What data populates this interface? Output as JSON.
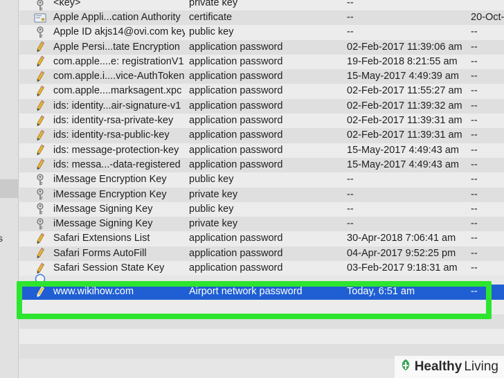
{
  "items": [
    {
      "icon": "key-icon",
      "name": "<key>",
      "kind": "private key",
      "date": "--",
      "expires": ""
    },
    {
      "icon": "certificate-icon",
      "name": "Apple Appli...cation Authority",
      "kind": "certificate",
      "date": "--",
      "expires": "20-Oct-"
    },
    {
      "icon": "key-icon",
      "name": "Apple ID akjs14@ovi.com key",
      "kind": "public key",
      "date": "--",
      "expires": "--"
    },
    {
      "icon": "pencil-icon",
      "name": "Apple Persi...tate Encryption",
      "kind": "application password",
      "date": "02-Feb-2017 11:39:06 am",
      "expires": "--"
    },
    {
      "icon": "pencil-icon",
      "name": "com.apple....e: registrationV1",
      "kind": "application password",
      "date": "19-Feb-2018 8:21:55 am",
      "expires": "--"
    },
    {
      "icon": "pencil-icon",
      "name": "com.apple.i....vice-AuthToken",
      "kind": "application password",
      "date": "15-May-2017 4:49:39 am",
      "expires": "--"
    },
    {
      "icon": "pencil-icon",
      "name": "com.apple....marksagent.xpc",
      "kind": "application password",
      "date": "02-Feb-2017 11:55:27 am",
      "expires": "--"
    },
    {
      "icon": "pencil-icon",
      "name": "ids: identity...air-signature-v1",
      "kind": "application password",
      "date": "02-Feb-2017 11:39:32 am",
      "expires": "--"
    },
    {
      "icon": "pencil-icon",
      "name": "ids: identity-rsa-private-key",
      "kind": "application password",
      "date": "02-Feb-2017 11:39:31 am",
      "expires": "--"
    },
    {
      "icon": "pencil-icon",
      "name": "ids: identity-rsa-public-key",
      "kind": "application password",
      "date": "02-Feb-2017 11:39:31 am",
      "expires": "--"
    },
    {
      "icon": "pencil-icon",
      "name": "ids: message-protection-key",
      "kind": "application password",
      "date": "15-May-2017 4:49:43 am",
      "expires": "--"
    },
    {
      "icon": "pencil-icon",
      "name": "ids: messa...-data-registered",
      "kind": "application password",
      "date": "15-May-2017 4:49:43 am",
      "expires": "--"
    },
    {
      "icon": "key-icon",
      "name": "iMessage Encryption Key",
      "kind": "public key",
      "date": "--",
      "expires": "--"
    },
    {
      "icon": "key-icon",
      "name": "iMessage Encryption Key",
      "kind": "private key",
      "date": "--",
      "expires": "--"
    },
    {
      "icon": "key-icon",
      "name": "iMessage Signing Key",
      "kind": "public key",
      "date": "--",
      "expires": "--"
    },
    {
      "icon": "key-icon",
      "name": "iMessage Signing Key",
      "kind": "private key",
      "date": "--",
      "expires": "--"
    },
    {
      "icon": "pencil-icon",
      "name": "Safari Extensions List",
      "kind": "application password",
      "date": "30-Apr-2018 7:06:41 am",
      "expires": "--"
    },
    {
      "icon": "pencil-icon",
      "name": "Safari Forms AutoFill",
      "kind": "application password",
      "date": "04-Apr-2017 9:52:25 pm",
      "expires": "--"
    },
    {
      "icon": "pencil-icon",
      "name": "Safari Session State Key",
      "kind": "application password",
      "date": "03-Feb-2017 9:18:31 am",
      "expires": "--"
    }
  ],
  "selected_item": {
    "icon": "pencil-icon",
    "name": "www.wikihow.com",
    "kind": "Airport network password",
    "date": "Today, 6:51 am",
    "expires": "--"
  },
  "sidebar": {
    "edge_text": "s"
  },
  "watermark": {
    "part1": "Healthy",
    "part2": "Living"
  },
  "colors": {
    "selection": "#1f5fd3",
    "highlight": "#2de52f",
    "watermark_leaf": "#3aa655"
  }
}
